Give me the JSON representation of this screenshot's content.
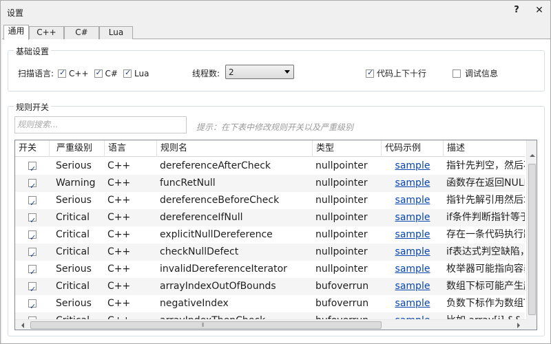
{
  "window": {
    "title": "设置",
    "help_label": "?",
    "close_label": "✕"
  },
  "tabs": [
    {
      "label": "通用",
      "active": true
    },
    {
      "label": "C++",
      "active": false
    },
    {
      "label": "C#",
      "active": false
    },
    {
      "label": "Lua",
      "active": false
    }
  ],
  "basic": {
    "group_title": "基础设置",
    "scan_label": "扫描语言:",
    "lang_cpp": {
      "label": "C++",
      "checked": true
    },
    "lang_cs": {
      "label": "C#",
      "checked": true
    },
    "lang_lua": {
      "label": "Lua",
      "checked": true
    },
    "threads_label": "线程数:",
    "threads_value": "2",
    "context": {
      "label": "代码上下十行",
      "checked": true
    },
    "debug": {
      "label": "调试信息",
      "checked": false
    }
  },
  "rules": {
    "group_title": "规则开关",
    "search_placeholder": "规则搜索...",
    "hint": "提示：在下表中修改规则开关以及严重级别",
    "columns": [
      "开关",
      "严重级别",
      "语言",
      "规则名",
      "类型",
      "代码示例",
      "描述"
    ],
    "rows": [
      {
        "enabled": true,
        "severity": "Serious",
        "lang": "C++",
        "name": "dereferenceAfterCheck",
        "type": "nullpointer",
        "sample": "sample",
        "desc": "指针先判空，然后石"
      },
      {
        "enabled": true,
        "severity": "Warning",
        "lang": "C++",
        "name": "funcRetNull",
        "type": "nullpointer",
        "sample": "sample",
        "desc": "函数存在返回NULL"
      },
      {
        "enabled": true,
        "severity": "Serious",
        "lang": "C++",
        "name": "dereferenceBeforeCheck",
        "type": "nullpointer",
        "sample": "sample",
        "desc": "指针先解引用然后才"
      },
      {
        "enabled": true,
        "severity": "Critical",
        "lang": "C++",
        "name": "dereferenceIfNull",
        "type": "nullpointer",
        "sample": "sample",
        "desc": "if条件判断指针等于"
      },
      {
        "enabled": true,
        "severity": "Critical",
        "lang": "C++",
        "name": "explicitNullDereference",
        "type": "nullpointer",
        "sample": "sample",
        "desc": "存在一条代码执行距"
      },
      {
        "enabled": true,
        "severity": "Critical",
        "lang": "C++",
        "name": "checkNullDefect",
        "type": "nullpointer",
        "sample": "sample",
        "desc": "if表达式判空缺陷，"
      },
      {
        "enabled": true,
        "severity": "Serious",
        "lang": "C++",
        "name": "invalidDereferenceIterator",
        "type": "nullpointer",
        "sample": "sample",
        "desc": "枚举器可能指向容器"
      },
      {
        "enabled": true,
        "severity": "Critical",
        "lang": "C++",
        "name": "arrayIndexOutOfBounds",
        "type": "bufoverrun",
        "sample": "sample",
        "desc": "数组下标可能产生起"
      },
      {
        "enabled": true,
        "severity": "Serious",
        "lang": "C++",
        "name": "negativeIndex",
        "type": "bufoverrun",
        "sample": "sample",
        "desc": "负数下标作为数组T"
      },
      {
        "enabled": true,
        "severity": "Critical",
        "lang": "C++",
        "name": "arrayIndexThenCheck",
        "type": "bufoverrun",
        "sample": "sample",
        "desc": "比如 array[i] && i"
      }
    ]
  }
}
